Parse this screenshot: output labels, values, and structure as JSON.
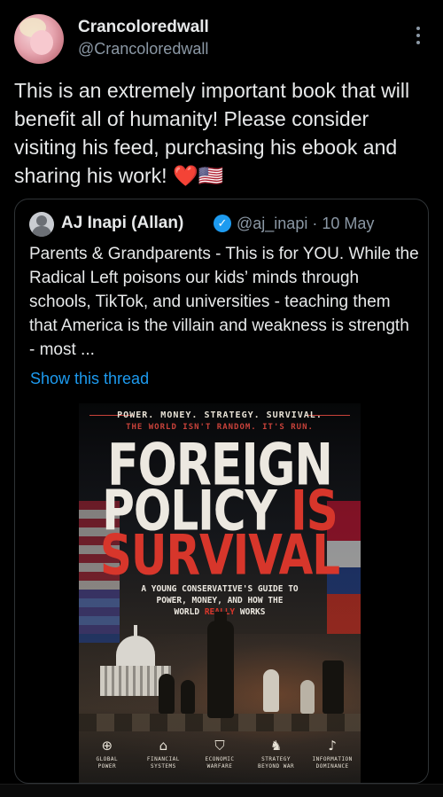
{
  "user": {
    "display_name": "Crancoloredwall",
    "handle": "@Crancoloredwall"
  },
  "tweet": {
    "text": "This is an extremely important book that will benefit all of humanity! Please consider visiting his feed, purchasing his ebook and sharing his work!",
    "emojis": [
      "❤️",
      "🇺🇸"
    ]
  },
  "quoted": {
    "name": "AJ Inapi (Allan)",
    "handle": "@aj_inapi",
    "separator": "·",
    "date": "10 May",
    "text": "Parents & Grandparents - This is for YOU. While the Radical Left poisons our kids’ minds through schools, TikTok, and universities - teaching them that America is the villain and weakness is strength - most ...",
    "show_thread": "Show this thread"
  },
  "book_cover": {
    "tagline": "POWER. MONEY. STRATEGY. SURVIVAL.",
    "subtagline": "THE WORLD ISN'T RANDOM. IT'S RUN.",
    "title_line1": "FOREIGN",
    "title_line2_a": "POLICY",
    "title_line2_b": "IS",
    "title_line3": "SURVIVAL",
    "guide_line1": "A YOUNG CONSERVATIVE'S GUIDE TO",
    "guide_line2": "POWER, MONEY, AND HOW THE",
    "guide_line3_a": "WORLD",
    "guide_line3_b": "REALLY",
    "guide_line3_c": "WORKS",
    "icons": [
      {
        "icon": "globe-icon",
        "glyph": "⊕",
        "label1": "GLOBAL",
        "label2": "POWER"
      },
      {
        "icon": "bank-icon",
        "glyph": "⌂",
        "label1": "FINANCIAL",
        "label2": "SYSTEMS"
      },
      {
        "icon": "shield-icon",
        "glyph": "⛉",
        "label1": "ECONOMIC",
        "label2": "WARFARE"
      },
      {
        "icon": "chess-knight-icon",
        "glyph": "♞",
        "label1": "STRATEGY",
        "label2": "BEYOND WAR"
      },
      {
        "icon": "microphone-icon",
        "glyph": "♪",
        "label1": "INFORMATION",
        "label2": "DOMINANCE"
      }
    ]
  },
  "colors": {
    "background": "#000000",
    "text": "#e7e9ea",
    "secondary": "#8b98a5",
    "link": "#1d9bf0",
    "cover_red": "#d7362b"
  }
}
